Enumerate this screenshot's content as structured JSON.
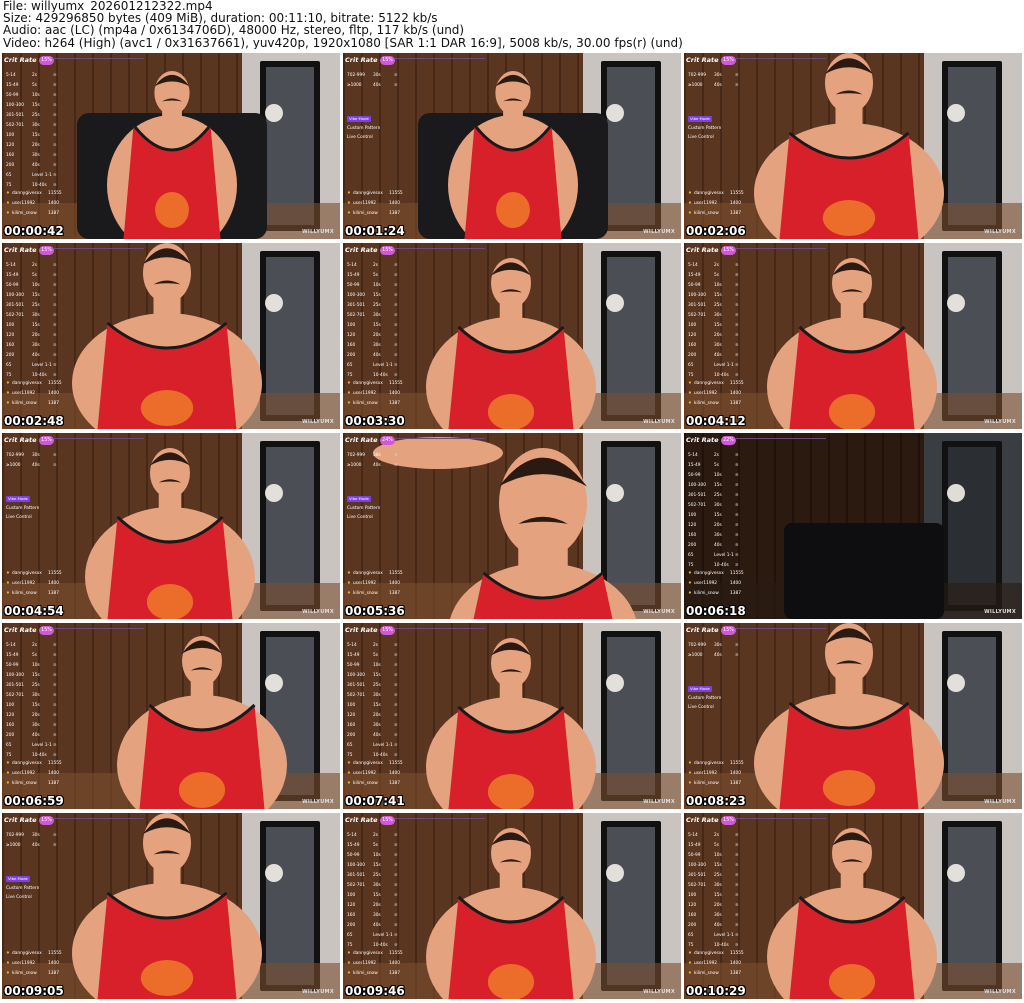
{
  "header": {
    "file": "File: willyumx_202601212322.mp4",
    "size": "Size: 429296850 bytes (409 MiB), duration: 00:11:10, bitrate: 5122 kb/s",
    "audio": "Audio: aac (LC) (mp4a / 0x6134706D), 48000 Hz, stereo, fltp, 117 kb/s (und)",
    "video": "Video: h264 (High) (avc1 / 0x31637661), yuv420p, 1920x1080 [SAR 1:1 DAR 16:9], 5008 kb/s, 30.00 fps(r) (und)"
  },
  "overlay": {
    "crit_label": "Crit Rate",
    "watermark": "WILLYUMX",
    "vibe_tag": "Vibe Mode",
    "custom_pattern": "Custom Pattern",
    "live_control": "Live Control",
    "level_label": "Level 1-1",
    "tip_table_full": [
      {
        "range": "5-14",
        "dur": "2s"
      },
      {
        "range": "15-49",
        "dur": "5s"
      },
      {
        "range": "50-99",
        "dur": "10s"
      },
      {
        "range": "100-300",
        "dur": "15s"
      },
      {
        "range": "301-501",
        "dur": "25s"
      },
      {
        "range": "502-701",
        "dur": "30s"
      },
      {
        "range": "100",
        "dur": "15s"
      },
      {
        "range": "120",
        "dur": "20s"
      },
      {
        "range": "160",
        "dur": "30s"
      },
      {
        "range": "200",
        "dur": "40s"
      },
      {
        "range": "65",
        "dur": "Level 1-1"
      },
      {
        "range": "75",
        "dur": "10-40s"
      }
    ],
    "tip_table_short": [
      {
        "range": "702-999",
        "dur": "30s"
      },
      {
        "range": "≥1000",
        "dur": "40s"
      }
    ],
    "leaderboard": [
      {
        "user": "dannygivesxx",
        "amount": "11555"
      },
      {
        "user": "user11992",
        "amount": "1400"
      },
      {
        "user": "kilimi_snow",
        "amount": "1387"
      }
    ]
  },
  "thumbnails": [
    {
      "ts": "00:00:42",
      "pct": "15%",
      "mode": "full",
      "tank": "#d8202a",
      "pose": "sit",
      "dark": false
    },
    {
      "ts": "00:01:24",
      "pct": "15%",
      "mode": "short",
      "tank": "#d8202a",
      "pose": "sit",
      "dark": false
    },
    {
      "ts": "00:02:06",
      "pct": "15%",
      "mode": "short",
      "tank": "#d8202a",
      "pose": "close",
      "dark": false
    },
    {
      "ts": "00:02:48",
      "pct": "15%",
      "mode": "full",
      "tank": "#d8202a",
      "pose": "close",
      "dark": false
    },
    {
      "ts": "00:03:30",
      "pct": "15%",
      "mode": "full",
      "tank": "#d8202a",
      "pose": "mid",
      "dark": false
    },
    {
      "ts": "00:04:12",
      "pct": "15%",
      "mode": "full",
      "tank": "#d8202a",
      "pose": "mid",
      "dark": false
    },
    {
      "ts": "00:04:54",
      "pct": "15%",
      "mode": "short",
      "tank": "#d8202a",
      "pose": "mid",
      "dark": false
    },
    {
      "ts": "00:05:36",
      "pct": "24%",
      "mode": "short",
      "tank": "#d8202a",
      "pose": "head",
      "dark": false
    },
    {
      "ts": "00:06:18",
      "pct": "22%",
      "mode": "full",
      "tank": "#d8202a",
      "pose": "empty",
      "dark": true
    },
    {
      "ts": "00:06:59",
      "pct": "15%",
      "mode": "full",
      "tank": "#d8202a",
      "pose": "lean",
      "dark": false
    },
    {
      "ts": "00:07:41",
      "pct": "15%",
      "mode": "full",
      "tank": "#d8202a",
      "pose": "mid",
      "dark": false
    },
    {
      "ts": "00:08:23",
      "pct": "15%",
      "mode": "short",
      "tank": "#d8202a",
      "pose": "close",
      "dark": false
    },
    {
      "ts": "00:09:05",
      "pct": "15%",
      "mode": "short",
      "tank": "#d8202a",
      "pose": "close",
      "dark": false
    },
    {
      "ts": "00:09:46",
      "pct": "15%",
      "mode": "full",
      "tank": "#d8202a",
      "pose": "mid",
      "dark": false
    },
    {
      "ts": "00:10:29",
      "pct": "15%",
      "mode": "full",
      "tank": "#d8202a",
      "pose": "mid",
      "dark": false
    }
  ]
}
